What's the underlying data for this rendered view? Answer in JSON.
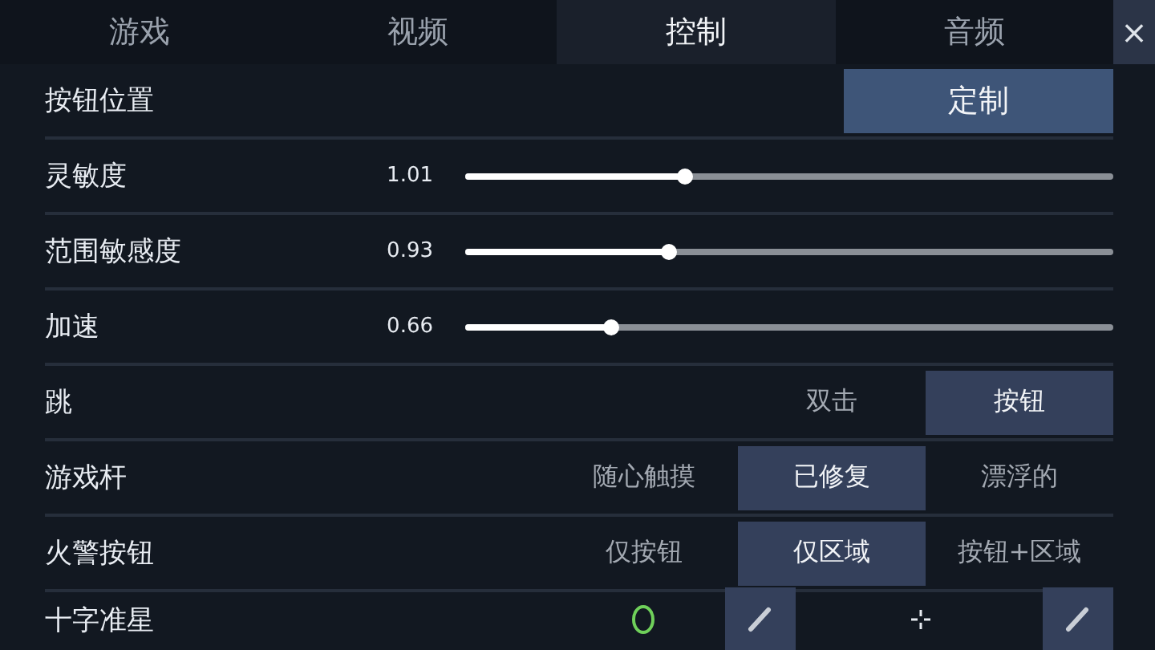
{
  "tabs": [
    {
      "label": "游戏",
      "selected": false
    },
    {
      "label": "视频",
      "selected": false
    },
    {
      "label": "控制",
      "selected": true
    },
    {
      "label": "音频",
      "selected": false
    }
  ],
  "close_button": "×",
  "settings": [
    {
      "kind": "button",
      "label": "按钮位置",
      "button": "定制"
    },
    {
      "kind": "slider",
      "label": "灵敏度",
      "reading": "1.01",
      "level": 0.34
    },
    {
      "kind": "slider",
      "label": "范围敏感度",
      "reading": "0.93",
      "level": 0.315
    },
    {
      "kind": "slider",
      "label": "加速",
      "reading": "0.66",
      "level": 0.226
    },
    {
      "kind": "choice",
      "label": "跳",
      "options": [
        {
          "label": "双击",
          "selected": false
        },
        {
          "label": "按钮",
          "selected": true
        }
      ]
    },
    {
      "kind": "choice",
      "label": "游戏杆",
      "options": [
        {
          "label": "随心触摸",
          "selected": false
        },
        {
          "label": "已修复",
          "selected": true
        },
        {
          "label": "漂浮的",
          "selected": false
        }
      ]
    },
    {
      "kind": "choice",
      "label": "火警按钮",
      "options": [
        {
          "label": "仅按钮",
          "selected": false
        },
        {
          "label": "仅区域",
          "selected": true
        },
        {
          "label": "按钮+区域",
          "selected": false
        }
      ]
    },
    {
      "kind": "crosshair",
      "label": "十字准星"
    }
  ]
}
